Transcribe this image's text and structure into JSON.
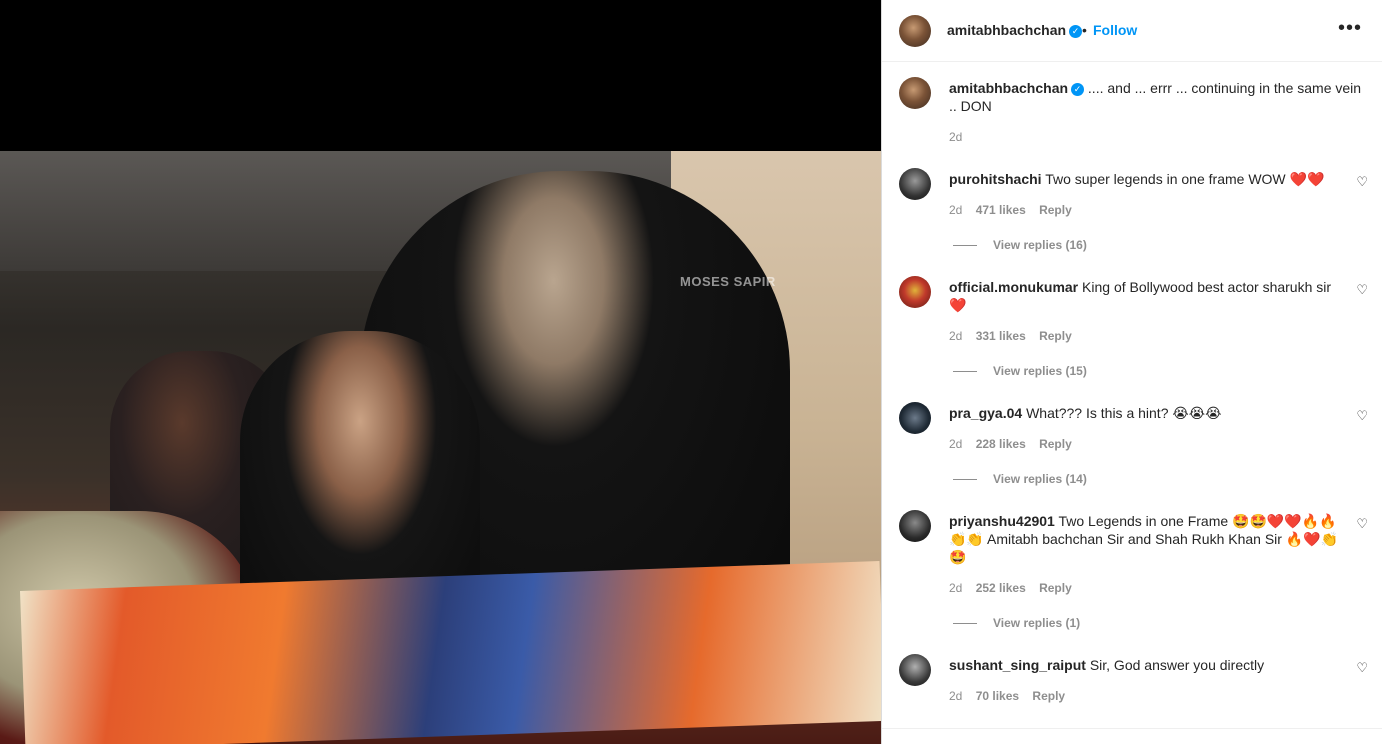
{
  "post": {
    "author": "amitabhbachchan",
    "follow_label": "Follow",
    "separator": "•",
    "more_icon": "more-options-icon",
    "more_label": "•••",
    "watermark": "MOSES SAPIR",
    "caption": {
      "username": "amitabhbachchan",
      "text": ".... and ... errr ... continuing in the same vein .. DON",
      "time": "2d"
    }
  },
  "comments": [
    {
      "username": "purohitshachi",
      "text": "Two super legends in one frame WOW ❤️❤️",
      "time": "2d",
      "likes": "471 likes",
      "reply_label": "Reply",
      "view_replies": "View replies (16)"
    },
    {
      "username": "official.monukumar",
      "text": "King of Bollywood best actor sharukh sir ❤️",
      "time": "2d",
      "likes": "331 likes",
      "reply_label": "Reply",
      "view_replies": "View replies (15)"
    },
    {
      "username": "pra_gya.04",
      "text": "What??? Is this a hint? 😭😭😭",
      "time": "2d",
      "likes": "228 likes",
      "reply_label": "Reply",
      "view_replies": "View replies (14)"
    },
    {
      "username": "priyanshu42901",
      "text": "Two Legends in one Frame 🤩🤩❤️❤️🔥🔥👏👏 Amitabh bachchan Sir and Shah Rukh Khan Sir 🔥❤️👏🤩",
      "time": "2d",
      "likes": "252 likes",
      "reply_label": "Reply",
      "view_replies": "View replies (1)"
    },
    {
      "username": "sushant_sing_raiput",
      "text": "Sir, God answer you directly",
      "time": "2d",
      "likes": "70 likes",
      "reply_label": "Reply"
    }
  ],
  "colors": {
    "accent": "#0095f6",
    "text": "#262626",
    "muted": "#8e8e8e"
  }
}
